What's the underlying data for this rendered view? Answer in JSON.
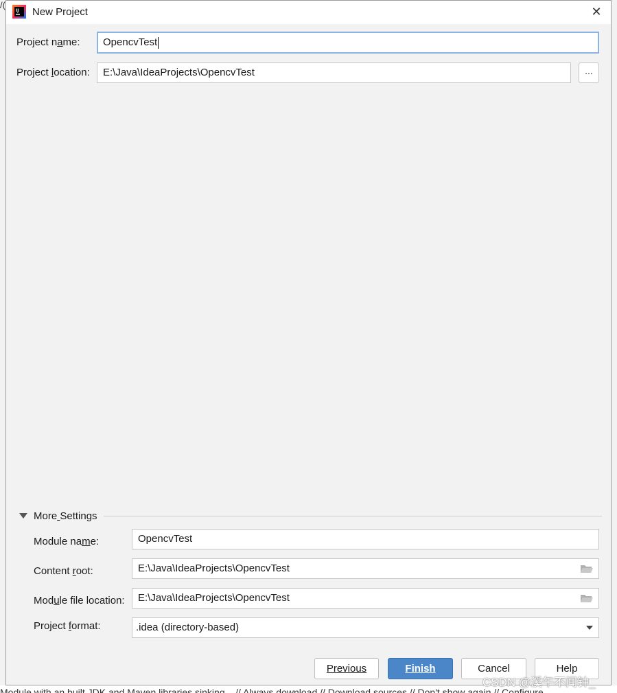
{
  "background": {
    "bottom_text": "Module with an built JDK and Maven libraries sinking...  // Always download  // Download sources  // Don't show again  // Configure"
  },
  "dialog": {
    "title": "New Project",
    "close_glyph": "✕",
    "icon": "intellij-idea-icon"
  },
  "project": {
    "name_label": "Project name:",
    "name_value": "OpencvTest",
    "location_label": "Project location:",
    "location_value": "E:\\Java\\IdeaProjects\\OpencvTest",
    "browse_label": "..."
  },
  "more_settings": {
    "header": "More Settings",
    "expanded": true,
    "module_name_label": "Module name:",
    "module_name_value": "OpencvTest",
    "content_root_label": "Content root:",
    "content_root_value": "E:\\Java\\IdeaProjects\\OpencvTest",
    "module_file_label": "Module file location:",
    "module_file_value": "E:\\Java\\IdeaProjects\\OpencvTest",
    "format_label": "Project format:",
    "format_value": ".idea (directory-based)"
  },
  "buttons": {
    "previous": "Previous",
    "finish": "Finish",
    "cancel": "Cancel",
    "help": "Help"
  },
  "watermark": "CSDN @溪午不闻钟_",
  "colors": {
    "accent": "#4a86c8",
    "focus_border": "#8db3e2",
    "dialog_bg": "#f2f2f2"
  }
}
